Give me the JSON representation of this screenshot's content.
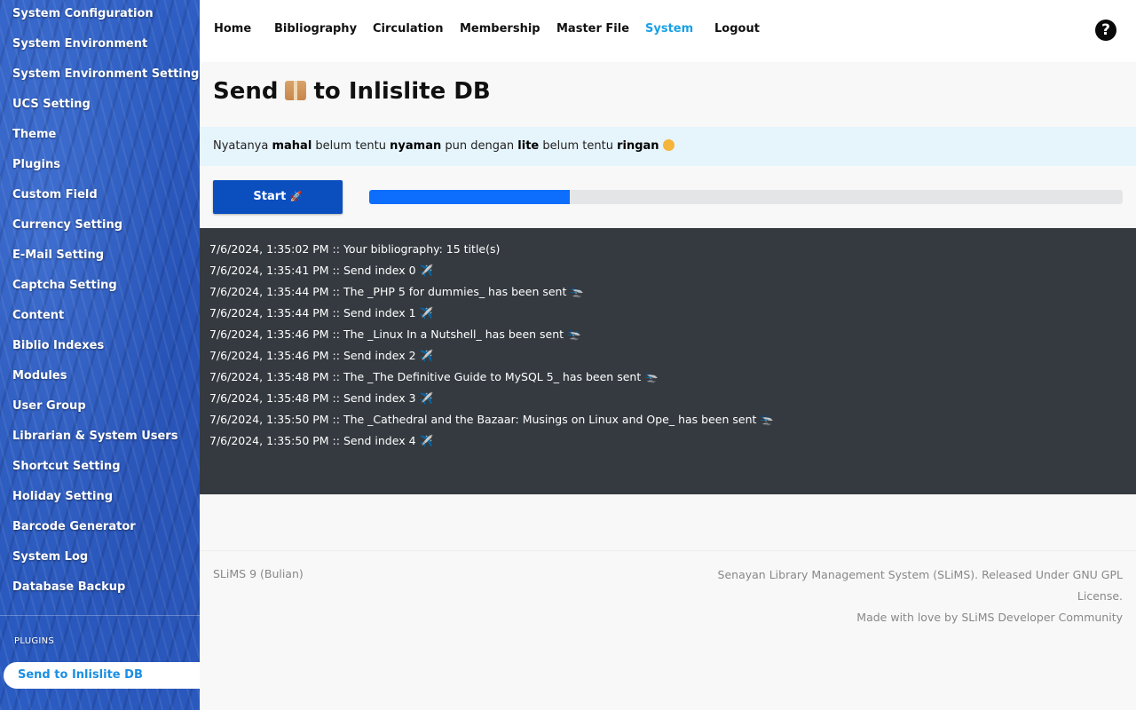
{
  "sidebar": {
    "items": [
      "System Configuration",
      "System Environment",
      "System Environment Setting",
      "UCS Setting",
      "Theme",
      "Plugins",
      "Custom Field",
      "Currency Setting",
      "E-Mail Setting",
      "Captcha Setting",
      "Content",
      "Biblio Indexes",
      "Modules",
      "User Group",
      "Librarian & System Users",
      "Shortcut Setting",
      "Holiday Setting",
      "Barcode Generator",
      "System Log",
      "Database Backup"
    ],
    "plugins_heading": "PLUGINS",
    "active_plugin": "Send to Inlislite DB"
  },
  "nav": {
    "items": [
      "Home",
      "Bibliography",
      "Circulation",
      "Membership",
      "Master File",
      "System",
      "Logout"
    ],
    "active": "System",
    "help_icon": "question-circle-icon",
    "help_glyph": "?"
  },
  "page": {
    "title_before": "Send",
    "title_icon": "package-icon",
    "title_after": "to Inlislite DB"
  },
  "info": {
    "t1": "Nyatanya ",
    "b1": "mahal",
    "t2": " belum tentu ",
    "b2": "nyaman",
    "t3": " pun dengan ",
    "b3": "lite",
    "t4": " belum tentu ",
    "b4": "ringan",
    "icon": "smile-face-icon"
  },
  "start_button": {
    "label": "Start",
    "icon": "rocket-icon",
    "glyph": "🚀"
  },
  "progress": {
    "fraction": 0.266,
    "color": "#0d6efd"
  },
  "log": [
    "7/6/2024, 1:35:02 PM :: Your bibliography: 15 title(s)",
    "7/6/2024, 1:35:41 PM :: Send index 0 ✈️",
    "7/6/2024, 1:35:44 PM :: The _PHP 5 for dummies_ has been sent 🛬",
    "7/6/2024, 1:35:44 PM :: Send index 1 ✈️",
    "7/6/2024, 1:35:46 PM :: The _Linux In a Nutshell_ has been sent 🛬",
    "7/6/2024, 1:35:46 PM :: Send index 2 ✈️",
    "7/6/2024, 1:35:48 PM :: The _The Definitive Guide to MySQL 5_ has been sent 🛬",
    "7/6/2024, 1:35:48 PM :: Send index 3 ✈️",
    "7/6/2024, 1:35:50 PM :: The _Cathedral and the Bazaar: Musings on Linux and Ope_ has been sent 🛬",
    "7/6/2024, 1:35:50 PM :: Send index 4 ✈️"
  ],
  "footer": {
    "version": "SLiMS 9 (Bulian)",
    "line1": "Senayan Library Management System (SLiMS). Released Under GNU GPL License.",
    "line2": "Made with love by SLiMS Developer Community"
  },
  "colors": {
    "accent": "#1aa0e6",
    "button": "#0b4fbf",
    "log_bg": "#343a40",
    "info_bg": "#e6f4fc"
  }
}
